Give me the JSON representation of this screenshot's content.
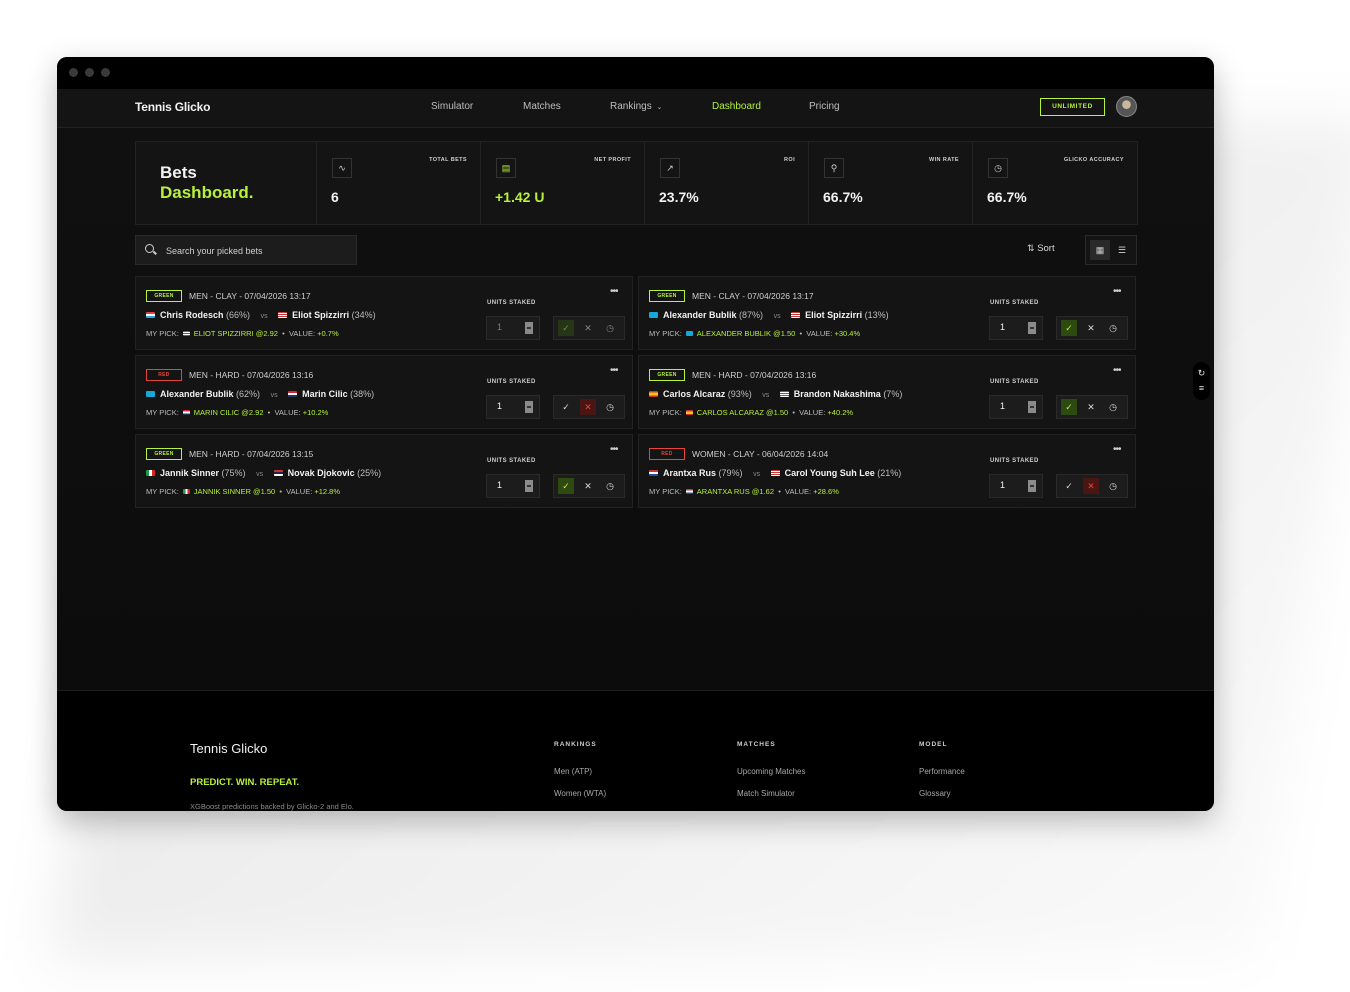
{
  "app": {
    "brand": "Tennis Glicko"
  },
  "nav": {
    "items": [
      "Simulator",
      "Matches",
      "Rankings",
      "Dashboard",
      "Pricing"
    ],
    "active": "Dashboard",
    "plan_badge": "UNLIMITED"
  },
  "dashboard": {
    "title_line1": "Bets",
    "title_line2": "Dashboard.",
    "stats": [
      {
        "label": "TOTAL BETS",
        "value": "6",
        "icon": "pulse-icon"
      },
      {
        "label": "NET PROFIT",
        "value": "+1.42 U",
        "icon": "wallet-icon"
      },
      {
        "label": "ROI",
        "value": "23.7%",
        "icon": "trend-up-icon"
      },
      {
        "label": "WIN RATE",
        "value": "66.7%",
        "icon": "trophy-icon"
      },
      {
        "label": "GLICKO ACCURACY",
        "value": "66.7%",
        "icon": "clock-icon"
      }
    ]
  },
  "toolbar": {
    "search_placeholder": "Search your picked bets",
    "sort_label": "Sort"
  },
  "labels": {
    "units_staked": "UNITS STAKED",
    "my_pick": "MY PICK:",
    "value": "VALUE:",
    "vs": "vs"
  },
  "bets": [
    {
      "status": "GREEN",
      "meta": "MEN - CLAY - 07/04/2026 13:17",
      "p1": "Chris Rodesch",
      "p1_pct": "(66%)",
      "p2": "Eliot Spizzirri",
      "p2_pct": "(34%)",
      "pick": "ELIOT SPIZZIRRI @2.92",
      "value": "+0.7%",
      "units": "1",
      "result": "win",
      "dim": true,
      "p1_flag": "lux",
      "p2_flag": "usa",
      "pick_flag": "usa"
    },
    {
      "status": "GREEN",
      "meta": "MEN - CLAY - 07/04/2026 13:17",
      "p1": "Alexander Bublik",
      "p1_pct": "(87%)",
      "p2": "Eliot Spizzirri",
      "p2_pct": "(13%)",
      "pick": "ALEXANDER BUBLIK @1.50",
      "value": "+30.4%",
      "units": "1",
      "result": "win",
      "dim": false,
      "p1_flag": "kaz",
      "p2_flag": "usa",
      "pick_flag": "kaz"
    },
    {
      "status": "RED",
      "meta": "MEN - HARD - 07/04/2026 13:16",
      "p1": "Alexander Bublik",
      "p1_pct": "(62%)",
      "p2": "Marin Cilic",
      "p2_pct": "(38%)",
      "pick": "MARIN CILIC @2.92",
      "value": "+10.2%",
      "units": "1",
      "result": "loss",
      "dim": false,
      "p1_flag": "kaz",
      "p2_flag": "cro",
      "pick_flag": "cro"
    },
    {
      "status": "GREEN",
      "meta": "MEN - HARD - 07/04/2026 13:16",
      "p1": "Carlos Alcaraz",
      "p1_pct": "(93%)",
      "p2": "Brandon Nakashima",
      "p2_pct": "(7%)",
      "pick": "CARLOS ALCARAZ @1.50",
      "value": "+40.2%",
      "units": "1",
      "result": "win",
      "dim": false,
      "p1_flag": "esp",
      "p2_flag": "usa",
      "pick_flag": "esp"
    },
    {
      "status": "GREEN",
      "meta": "MEN - HARD - 07/04/2026 13:15",
      "p1": "Jannik Sinner",
      "p1_pct": "(75%)",
      "p2": "Novak Djokovic",
      "p2_pct": "(25%)",
      "pick": "JANNIK SINNER @1.50",
      "value": "+12.8%",
      "units": "1",
      "result": "win",
      "dim": false,
      "p1_flag": "ita",
      "p2_flag": "srb",
      "pick_flag": "ita"
    },
    {
      "status": "RED",
      "meta": "WOMEN - CLAY - 06/04/2026 14:04",
      "p1": "Arantxa Rus",
      "p1_pct": "(79%)",
      "p2": "Carol Young Suh Lee",
      "p2_pct": "(21%)",
      "pick": "ARANTXA RUS @1.62",
      "value": "+28.6%",
      "units": "1",
      "result": "loss",
      "dim": false,
      "p1_flag": "ned",
      "p2_flag": "usa",
      "pick_flag": "ned"
    }
  ],
  "footer": {
    "brand": "Tennis Glicko",
    "tagline": "PREDICT. WIN. REPEAT.",
    "description": "XGBoost predictions backed by Glicko-2 and Elo.",
    "columns": [
      {
        "title": "RANKINGS",
        "links": [
          "Men (ATP)",
          "Women (WTA)"
        ]
      },
      {
        "title": "MATCHES",
        "links": [
          "Upcoming Matches",
          "Match Simulator"
        ]
      },
      {
        "title": "MODEL",
        "links": [
          "Performance",
          "Glossary"
        ]
      }
    ]
  },
  "colors": {
    "accent": "#b8f23a",
    "danger": "#e2463b",
    "bg": "#0f0f0f",
    "card": "#141414"
  }
}
